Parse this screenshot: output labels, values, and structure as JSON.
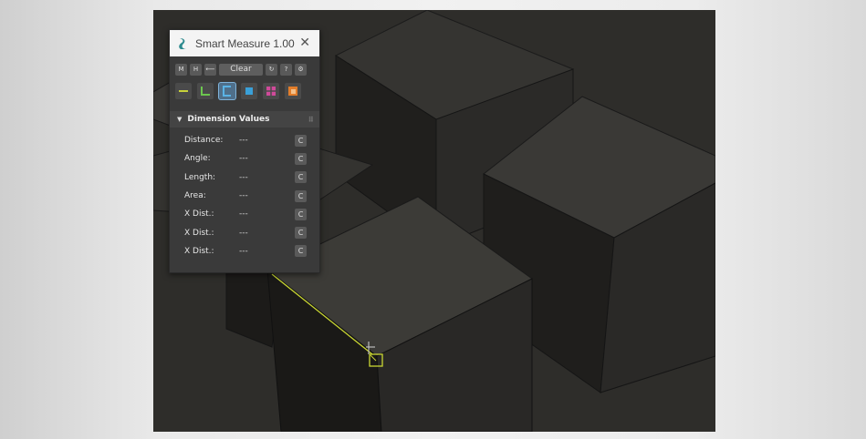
{
  "window": {
    "title": "Smart Measure 1.00",
    "close_glyph": "✕"
  },
  "toolbar": {
    "buttons": [
      "M",
      "H",
      "⟵",
      "Clear",
      "↻",
      "?",
      "⚙"
    ]
  },
  "tools": [
    {
      "icon": "line-measure-icon",
      "color": "#c8d23a"
    },
    {
      "icon": "angle-measure-icon",
      "color": "#6cc64f"
    },
    {
      "icon": "length-measure-icon",
      "color": "#5ab3e6"
    },
    {
      "icon": "area-measure-icon",
      "color": "#3aa0d8"
    },
    {
      "icon": "x-dist-measure-icon",
      "color": "#d04a9a"
    },
    {
      "icon": "box-measure-icon",
      "color": "#e27d2a"
    }
  ],
  "section": {
    "title": "Dimension Values",
    "arrow": "▼",
    "menu": "⠿"
  },
  "rows": [
    {
      "label": "Distance:",
      "value": "---",
      "button": "C"
    },
    {
      "label": "Angle:",
      "value": "---",
      "button": "C"
    },
    {
      "label": "Length:",
      "value": "---",
      "button": "C"
    },
    {
      "label": "Area:",
      "value": "---",
      "button": "C"
    },
    {
      "label": "X Dist.:",
      "value": "---",
      "button": "C"
    },
    {
      "label": "X Dist.:",
      "value": "---",
      "button": "C"
    },
    {
      "label": "X Dist.:",
      "value": "---",
      "button": "C"
    }
  ],
  "colors": {
    "accent": "#7fb2d9",
    "measure_line": "#c9d633",
    "viewport_bg": "#2e2d2a"
  }
}
